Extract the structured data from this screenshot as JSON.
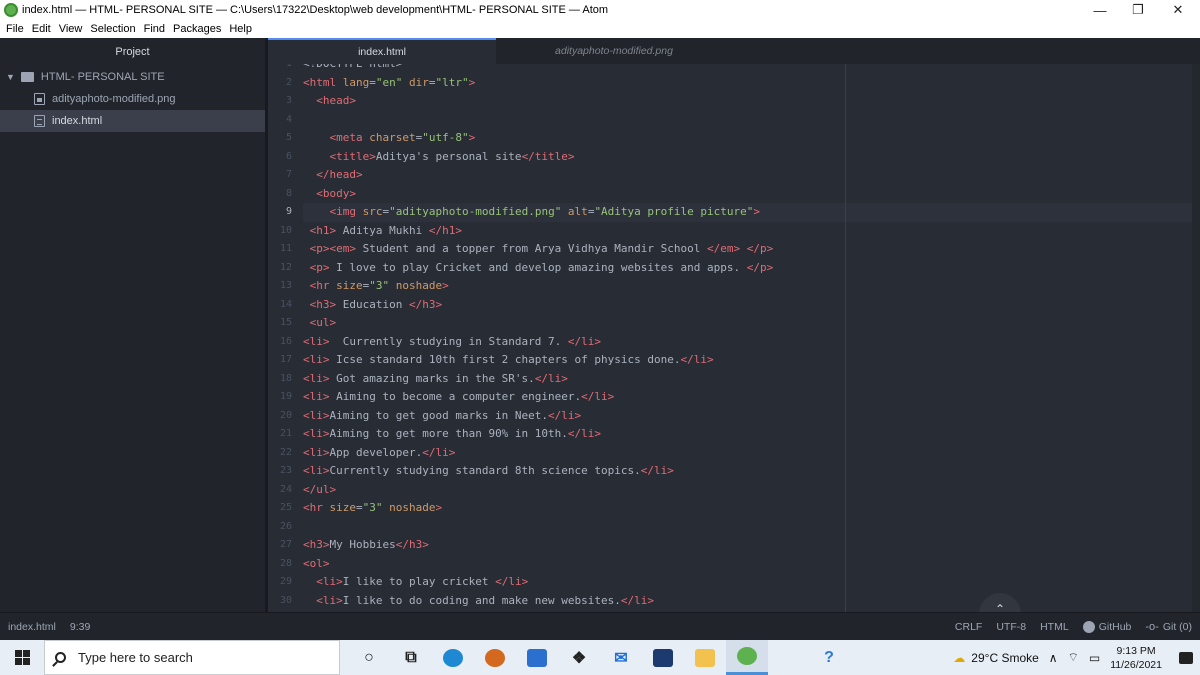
{
  "window": {
    "title": "index.html — HTML- PERSONAL SITE — C:\\Users\\17322\\Desktop\\web development\\HTML- PERSONAL SITE — Atom",
    "controls": {
      "minimize": "—",
      "restore": "❐",
      "close": "✕"
    }
  },
  "menu": [
    "File",
    "Edit",
    "View",
    "Selection",
    "Find",
    "Packages",
    "Help"
  ],
  "tree": {
    "header": "Project",
    "root": "HTML- PERSONAL SITE",
    "files": [
      "adityaphoto-modified.png",
      "index.html"
    ],
    "selected": "index.html"
  },
  "tabs": {
    "active": "index.html",
    "inactive": "adityaphoto-modified.png"
  },
  "editor": {
    "current_line": 9,
    "lines": [
      {
        "n": "1",
        "tokens": [
          [
            "p",
            "<!DOCTYPE html>"
          ]
        ]
      },
      {
        "n": "2",
        "tokens": [
          [
            "t",
            "<html"
          ],
          [
            "a",
            " lang"
          ],
          [
            "p",
            "="
          ],
          [
            "s",
            "\"en\""
          ],
          [
            "a",
            " dir"
          ],
          [
            "p",
            "="
          ],
          [
            "s",
            "\"ltr\""
          ],
          [
            "t",
            ">"
          ]
        ]
      },
      {
        "n": "3",
        "tokens": [
          [
            "p",
            "  "
          ],
          [
            "t",
            "<head>"
          ]
        ]
      },
      {
        "n": "4",
        "tokens": []
      },
      {
        "n": "5",
        "tokens": [
          [
            "p",
            "    "
          ],
          [
            "t",
            "<meta"
          ],
          [
            "a",
            " charset"
          ],
          [
            "p",
            "="
          ],
          [
            "s",
            "\"utf-8\""
          ],
          [
            "t",
            ">"
          ]
        ]
      },
      {
        "n": "6",
        "tokens": [
          [
            "p",
            "    "
          ],
          [
            "t",
            "<title>"
          ],
          [
            "p",
            "Aditya's personal site"
          ],
          [
            "t",
            "</title>"
          ]
        ]
      },
      {
        "n": "7",
        "tokens": [
          [
            "p",
            "  "
          ],
          [
            "t",
            "</head>"
          ]
        ]
      },
      {
        "n": "8",
        "tokens": [
          [
            "p",
            "  "
          ],
          [
            "t",
            "<body>"
          ]
        ]
      },
      {
        "n": "9",
        "tokens": [
          [
            "p",
            "    "
          ],
          [
            "t",
            "<img"
          ],
          [
            "a",
            " src"
          ],
          [
            "p",
            "="
          ],
          [
            "s",
            "\"adityaphoto-modified.png\""
          ],
          [
            "a",
            " alt"
          ],
          [
            "p",
            "="
          ],
          [
            "s",
            "\"Aditya profile picture\""
          ],
          [
            "t",
            ">"
          ]
        ]
      },
      {
        "n": "10",
        "tokens": [
          [
            "p",
            " "
          ],
          [
            "t",
            "<h1>"
          ],
          [
            "p",
            " Aditya Mukhi "
          ],
          [
            "t",
            "</h1>"
          ]
        ]
      },
      {
        "n": "11",
        "tokens": [
          [
            "p",
            " "
          ],
          [
            "t",
            "<p><em>"
          ],
          [
            "p",
            " Student and a topper from Arya Vidhya Mandir School "
          ],
          [
            "t",
            "</em>"
          ],
          [
            "p",
            " "
          ],
          [
            "t",
            "</p>"
          ]
        ]
      },
      {
        "n": "12",
        "tokens": [
          [
            "p",
            " "
          ],
          [
            "t",
            "<p>"
          ],
          [
            "p",
            " I love to play Cricket and develop amazing websites and apps. "
          ],
          [
            "t",
            "</p>"
          ]
        ]
      },
      {
        "n": "13",
        "tokens": [
          [
            "p",
            " "
          ],
          [
            "t",
            "<hr"
          ],
          [
            "a",
            " size"
          ],
          [
            "p",
            "="
          ],
          [
            "s",
            "\"3\""
          ],
          [
            "a",
            " noshade"
          ],
          [
            "t",
            ">"
          ]
        ]
      },
      {
        "n": "14",
        "tokens": [
          [
            "p",
            " "
          ],
          [
            "t",
            "<h3>"
          ],
          [
            "p",
            " Education "
          ],
          [
            "t",
            "</h3>"
          ]
        ]
      },
      {
        "n": "15",
        "tokens": [
          [
            "p",
            " "
          ],
          [
            "t",
            "<ul>"
          ]
        ]
      },
      {
        "n": "16",
        "tokens": [
          [
            "t",
            "<li>"
          ],
          [
            "p",
            "  Currently studying in Standard 7. "
          ],
          [
            "t",
            "</li>"
          ]
        ]
      },
      {
        "n": "17",
        "tokens": [
          [
            "t",
            "<li>"
          ],
          [
            "p",
            " Icse standard 10th first 2 chapters of physics done."
          ],
          [
            "t",
            "</li>"
          ]
        ]
      },
      {
        "n": "18",
        "tokens": [
          [
            "t",
            "<li>"
          ],
          [
            "p",
            " Got amazing marks in the SR's."
          ],
          [
            "t",
            "</li>"
          ]
        ]
      },
      {
        "n": "19",
        "tokens": [
          [
            "t",
            "<li>"
          ],
          [
            "p",
            " Aiming to become a computer engineer."
          ],
          [
            "t",
            "</li>"
          ]
        ]
      },
      {
        "n": "20",
        "tokens": [
          [
            "t",
            "<li>"
          ],
          [
            "p",
            "Aiming to get good marks in Neet."
          ],
          [
            "t",
            "</li>"
          ]
        ]
      },
      {
        "n": "21",
        "tokens": [
          [
            "t",
            "<li>"
          ],
          [
            "p",
            "Aiming to get more than 90% in 10th."
          ],
          [
            "t",
            "</li>"
          ]
        ]
      },
      {
        "n": "22",
        "tokens": [
          [
            "t",
            "<li>"
          ],
          [
            "p",
            "App developer."
          ],
          [
            "t",
            "</li>"
          ]
        ]
      },
      {
        "n": "23",
        "tokens": [
          [
            "t",
            "<li>"
          ],
          [
            "p",
            "Currently studying standard 8th science topics."
          ],
          [
            "t",
            "</li>"
          ]
        ]
      },
      {
        "n": "24",
        "tokens": [
          [
            "t",
            "</ul>"
          ]
        ]
      },
      {
        "n": "25",
        "tokens": [
          [
            "t",
            "<hr"
          ],
          [
            "a",
            " size"
          ],
          [
            "p",
            "="
          ],
          [
            "s",
            "\"3\""
          ],
          [
            "a",
            " noshade"
          ],
          [
            "t",
            ">"
          ]
        ]
      },
      {
        "n": "26",
        "tokens": []
      },
      {
        "n": "27",
        "tokens": [
          [
            "t",
            "<h3>"
          ],
          [
            "p",
            "My Hobbies"
          ],
          [
            "t",
            "</h3>"
          ]
        ]
      },
      {
        "n": "28",
        "tokens": [
          [
            "t",
            "<ol>"
          ]
        ]
      },
      {
        "n": "29",
        "tokens": [
          [
            "p",
            "  "
          ],
          [
            "t",
            "<li>"
          ],
          [
            "p",
            "I like to play cricket "
          ],
          [
            "t",
            "</li>"
          ]
        ]
      },
      {
        "n": "30",
        "tokens": [
          [
            "p",
            "  "
          ],
          [
            "t",
            "<li>"
          ],
          [
            "p",
            "I like to do coding and make new websites."
          ],
          [
            "t",
            "</li>"
          ]
        ]
      }
    ],
    "scroll_top_icon": "chevron-up-icon",
    "scroll_top_glyph": "⌃"
  },
  "status": {
    "file": "index.html",
    "cursor": "9:39",
    "line_ending": "CRLF",
    "encoding": "UTF-8",
    "grammar": "HTML",
    "github": "GitHub",
    "git": "Git (0)",
    "git_glyph": "-o-"
  },
  "taskbar": {
    "search_placeholder": "Type here to search",
    "apps": [
      {
        "name": "cortana-icon",
        "glyph": "○",
        "color": "#222222"
      },
      {
        "name": "task-view-icon",
        "glyph": "⧉",
        "color": "#222222"
      },
      {
        "name": "edge-icon",
        "glyph": "",
        "color": "#1e88d3"
      },
      {
        "name": "game-icon",
        "glyph": "",
        "color": "#d2691e"
      },
      {
        "name": "store-icon",
        "glyph": "",
        "color": "#2b6fcf"
      },
      {
        "name": "dropbox-icon",
        "glyph": "❖",
        "color": "#222222"
      },
      {
        "name": "mail-icon",
        "glyph": "✉",
        "color": "#1e6fd9"
      },
      {
        "name": "powershell-icon",
        "glyph": "",
        "color": "#1c3a6e"
      },
      {
        "name": "file-explorer-icon",
        "glyph": "",
        "color": "#f2c14e"
      },
      {
        "name": "atom-icon",
        "glyph": "",
        "color": "#5db14e",
        "active": true
      },
      {
        "name": "help-icon",
        "glyph": "?",
        "color": "#2b7bd6"
      }
    ],
    "weather": "29°C  Smoke",
    "time": "9:13 PM",
    "date": "11/26/2021"
  },
  "colors": {
    "editor_bg": "#282c34",
    "sidebar_bg": "#21252b",
    "tag": "#e06c75",
    "attribute": "#d19a66",
    "string": "#98c379",
    "text": "#abb2bf",
    "accent": "#568af2"
  }
}
